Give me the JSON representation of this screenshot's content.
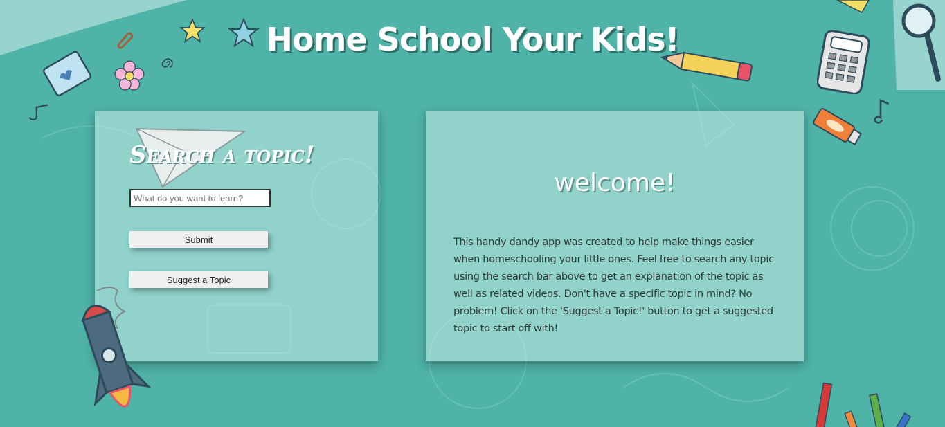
{
  "header": {
    "title": "Home School Your Kids!"
  },
  "search_panel": {
    "heading": "Search a topic!",
    "input": {
      "placeholder": "What do you want to learn?",
      "value": ""
    },
    "submit_label": "Submit",
    "suggest_label": "Suggest a Topic"
  },
  "welcome_panel": {
    "heading": "welcome!",
    "body": "This handy dandy app was created to help make things easier when homeschooling your little ones. Feel free to search any topic using the search bar above to get an explanation of the topic as well as related videos. Don't have a specific topic in mind? No problem! Click on the 'Suggest a Topic!' button to get a suggested topic to start off with!"
  },
  "colors": {
    "background": "#4fb3a8",
    "panel": "#c8ebe8",
    "title": "#ffffff",
    "button": "#efefef"
  },
  "icons": [
    "star-icon",
    "paperclip-icon",
    "flower-icon",
    "notebook-icon",
    "pencil-icon",
    "calculator-icon",
    "magnifier-icon",
    "paint-tube-icon",
    "music-note-icon",
    "paper-plane-icon",
    "rocket-icon",
    "crayon-icon"
  ]
}
